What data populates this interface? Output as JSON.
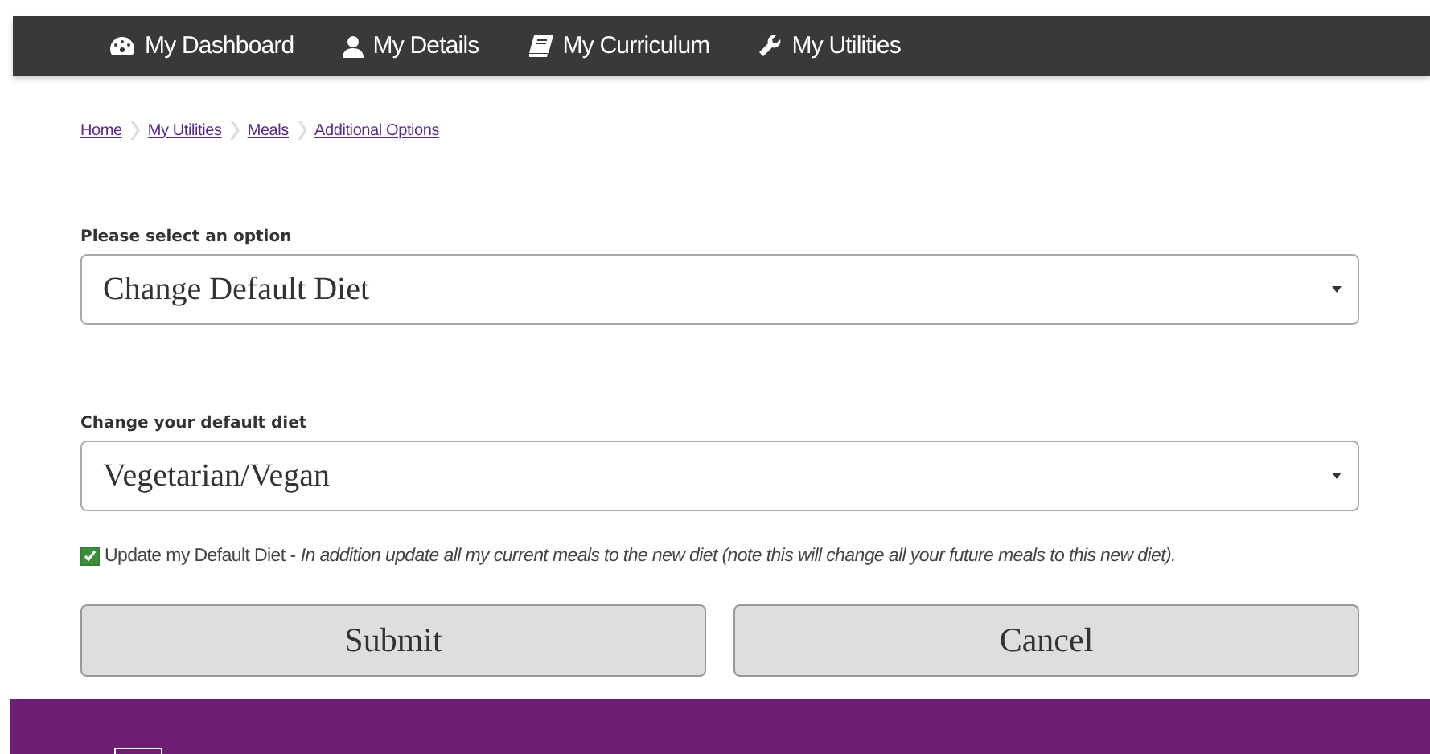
{
  "nav": [
    {
      "kind": "dashboard",
      "label": "My Dashboard"
    },
    {
      "kind": "person",
      "label": "My Details"
    },
    {
      "kind": "book",
      "label": "My Curriculum"
    },
    {
      "kind": "wrench",
      "label": "My Utilities"
    }
  ],
  "breadcrumbs": [
    "Home",
    "My Utilities",
    "Meals",
    "Additional Options"
  ],
  "fields": [
    {
      "label": "Please select an option",
      "value": "Change Default Diet"
    },
    {
      "label": "Change your default diet",
      "value": "Vegetarian/Vegan"
    }
  ],
  "checkbox": {
    "checked": true,
    "label": "Update my Default Diet",
    "separator": "-",
    "note": "In addition update all my current meals to the new diet (note this will change all your future meals to this new diet)."
  },
  "buttons": [
    "Submit",
    "Cancel"
  ]
}
